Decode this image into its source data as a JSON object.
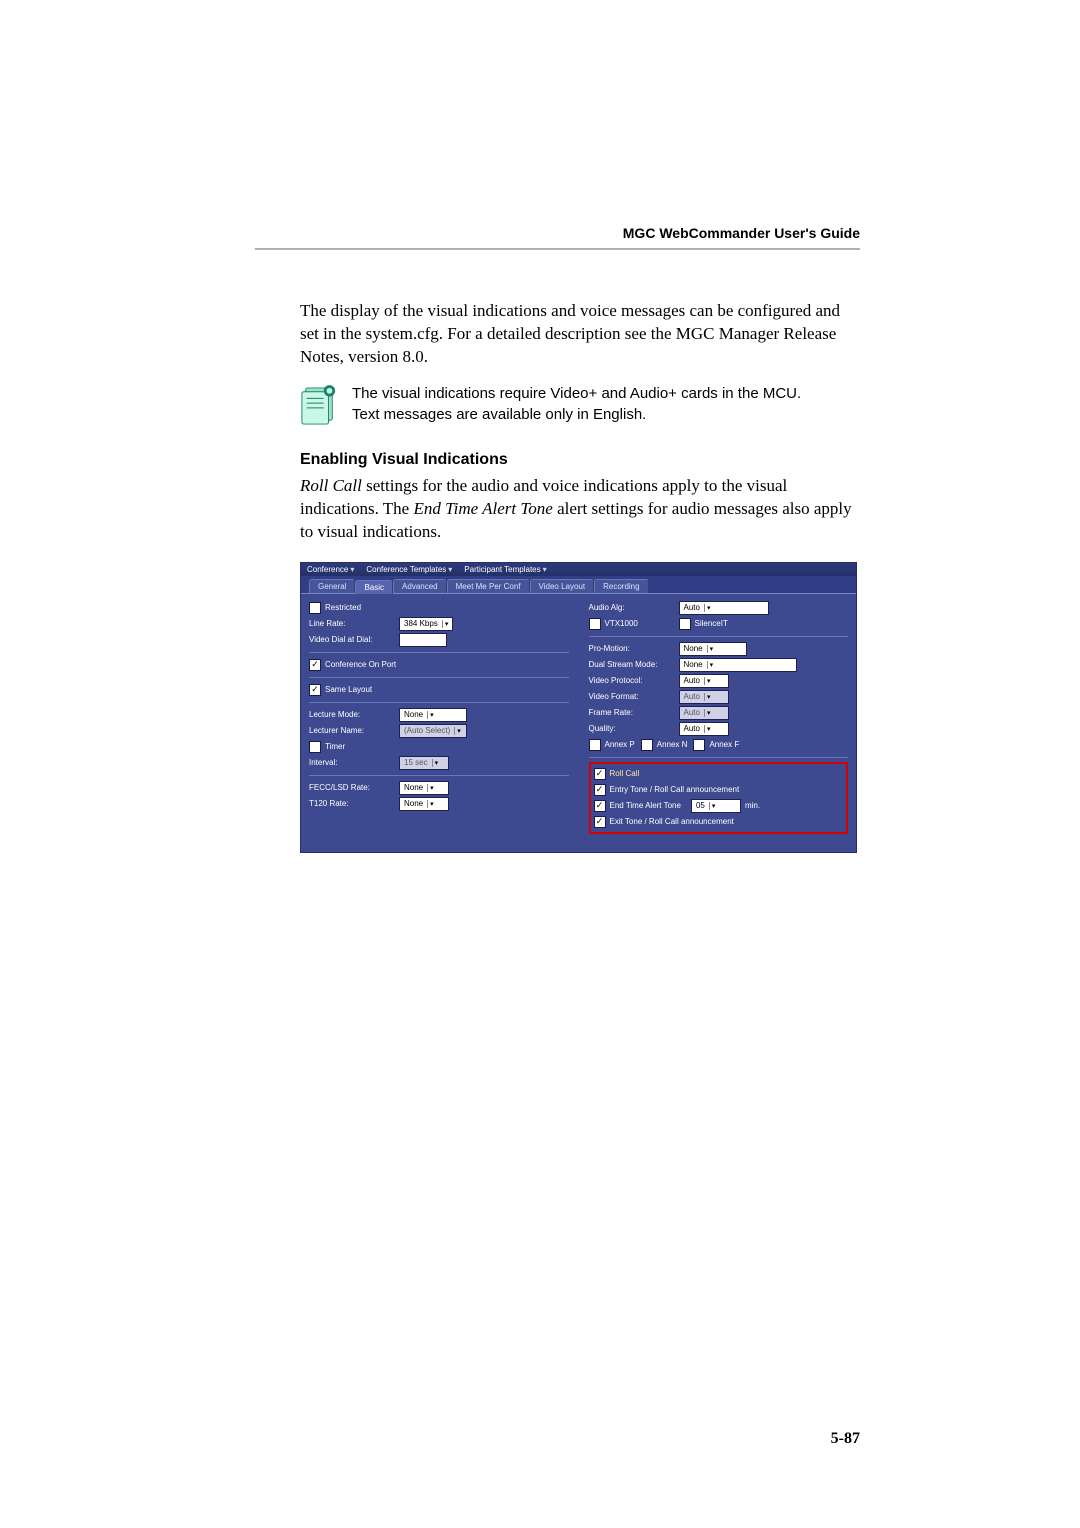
{
  "header": {
    "title": "MGC WebCommander User's Guide"
  },
  "para1": "The display of the visual indications and voice messages can be configured and set in the system.cfg. For a detailed description see the MGC Manager Release Notes, version 8.0.",
  "note": {
    "line1": "The visual indications require Video+ and Audio+ cards in the MCU.",
    "line2": "Text messages are available only in English."
  },
  "heading": "Enabling Visual Indications",
  "para2_before": "Roll Call",
  "para2_mid1": " settings for the audio and voice indications apply to the visual indications. The ",
  "para2_em": "End Time Alert Tone",
  "para2_after": " alert settings for audio messages also apply to visual indications.",
  "screenshot": {
    "menus": {
      "m1": "Conference",
      "m2": "Conference Templates",
      "m3": "Participant Templates"
    },
    "tabs": {
      "general": "General",
      "basic": "Basic",
      "advanced": "Advanced",
      "meetme": "Meet Me Per Conf",
      "video": "Video Layout",
      "recording": "Recording"
    },
    "left": {
      "restricted": "Restricted",
      "line_rate_lbl": "Line Rate:",
      "line_rate_val": "384 Kbps",
      "visual_dial_lbl": "Video Dial at Dial:",
      "conf_on_port": "Conference On Port",
      "same_layout": "Same Layout",
      "lecture_mode_lbl": "Lecture Mode:",
      "lecture_mode_val": "None",
      "lecturer_name_lbl": "Lecturer Name:",
      "lecturer_name_val": "(Auto Select)",
      "timer": "Timer",
      "interval_lbl": "Interval:",
      "interval_val": "15 sec",
      "fecc_lbl": "FECC/LSD Rate:",
      "fecc_val": "None",
      "t120_lbl": "T120 Rate:",
      "t120_val": "None"
    },
    "right": {
      "audio_alg_lbl": "Audio Alg:",
      "audio_alg_val": "Auto",
      "vtx1000": "VTX1000",
      "silenceit": "SilenceIT",
      "promotion_lbl": "Pro-Motion:",
      "promotion_val": "None",
      "dualstream_lbl": "Dual Stream Mode:",
      "dualstream_val": "None",
      "videoproto_lbl": "Video Protocol:",
      "videoproto_val": "Auto",
      "videoformat_lbl": "Video Format:",
      "videoformat_val": "Auto",
      "framerate_lbl": "Frame Rate:",
      "framerate_val": "Auto",
      "quality_lbl": "Quality:",
      "quality_val": "Auto",
      "annexp": "Annex P",
      "annexn": "Annex N",
      "annexf": "Annex F",
      "rollcall": "Roll Call",
      "entrytone": "Entry Tone / Roll Call announcement",
      "endtime_lbl": "End Time Alert Tone",
      "endtime_val": "05",
      "endtime_unit": "min.",
      "exittone": "Exit Tone / Roll Call announcement"
    }
  },
  "page_number": "5-87"
}
